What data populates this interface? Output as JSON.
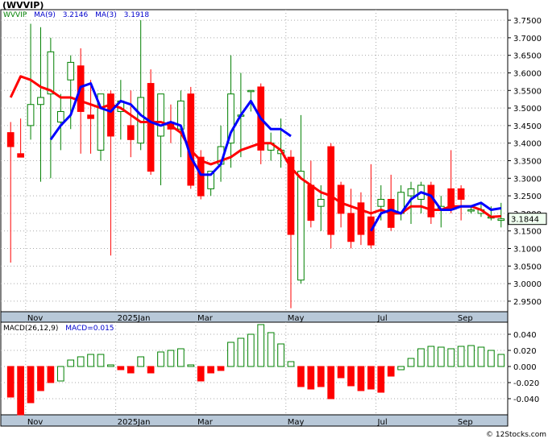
{
  "header": {
    "title": "(WVVIP)",
    "legend": [
      {
        "label": "WVVIP",
        "color": "#008000"
      },
      {
        "label": "MA(9)",
        "color": "#0000cc"
      },
      {
        "label": "3.2146",
        "color": "#0000cc"
      },
      {
        "label": "MA(3)",
        "color": "#0000cc"
      },
      {
        "label": "3.1918",
        "color": "#0000cc"
      }
    ],
    "macd_legend": [
      {
        "label": "MACD(26,12,9)",
        "color": "#000000"
      },
      {
        "label": "MACD=0.015",
        "color": "#0000cc"
      }
    ],
    "credit": "© 12Stocks.com"
  },
  "colors": {
    "up": "#008000",
    "down": "#ff0000",
    "ma9": "#0000ff",
    "ma3": "#ff0000",
    "grid": "#aaaaaa",
    "axis_bg": "#b8c8d8"
  },
  "chart_data": [
    {
      "type": "candlestick",
      "ylim": [
        2.92,
        3.78
      ],
      "yticks": [
        "3.7500",
        "3.7000",
        "3.6500",
        "3.6000",
        "3.5500",
        "3.5000",
        "3.4500",
        "3.4000",
        "3.3500",
        "3.3000",
        "3.2500",
        "3.2000",
        "3.1500",
        "3.1000",
        "3.0500",
        "3.0000",
        "2.9500"
      ],
      "ytick_values": [
        3.75,
        3.7,
        3.65,
        3.6,
        3.55,
        3.5,
        3.45,
        3.4,
        3.35,
        3.3,
        3.25,
        3.2,
        3.15,
        3.1,
        3.05,
        3.0,
        2.95
      ],
      "xticks": [
        {
          "label": "Nov",
          "i": 2
        },
        {
          "label": "2025Jan",
          "i": 11
        },
        {
          "label": "Mar",
          "i": 19
        },
        {
          "label": "May",
          "i": 28
        },
        {
          "label": "Jul",
          "i": 37
        },
        {
          "label": "Sep",
          "i": 45
        }
      ],
      "last_price_label": "3.1844",
      "last_price": 3.1844,
      "ohlc": [
        [
          3.43,
          3.46,
          3.06,
          3.39
        ],
        [
          3.37,
          3.47,
          3.36,
          3.36
        ],
        [
          3.45,
          3.74,
          3.41,
          3.51
        ],
        [
          3.51,
          3.73,
          3.29,
          3.53
        ],
        [
          3.54,
          3.7,
          3.3,
          3.66
        ],
        [
          3.46,
          3.54,
          3.38,
          3.49
        ],
        [
          3.58,
          3.65,
          3.44,
          3.63
        ],
        [
          3.62,
          3.67,
          3.37,
          3.49
        ],
        [
          3.48,
          3.58,
          3.37,
          3.47
        ],
        [
          3.38,
          3.53,
          3.35,
          3.54
        ],
        [
          3.54,
          3.55,
          3.08,
          3.42
        ],
        [
          3.49,
          3.58,
          3.41,
          3.52
        ],
        [
          3.45,
          3.55,
          3.36,
          3.41
        ],
        [
          3.4,
          3.75,
          3.38,
          3.53
        ],
        [
          3.57,
          3.61,
          3.31,
          3.32
        ],
        [
          3.42,
          3.52,
          3.28,
          3.54
        ],
        [
          3.46,
          3.51,
          3.4,
          3.44
        ],
        [
          3.44,
          3.55,
          3.36,
          3.52
        ],
        [
          3.54,
          3.56,
          3.27,
          3.28
        ],
        [
          3.36,
          3.38,
          3.24,
          3.25
        ],
        [
          3.27,
          3.31,
          3.25,
          3.32
        ],
        [
          3.34,
          3.45,
          3.29,
          3.39
        ],
        [
          3.4,
          3.65,
          3.33,
          3.54
        ],
        [
          3.48,
          3.6,
          3.36,
          3.48
        ],
        [
          3.55,
          3.55,
          3.49,
          3.55
        ],
        [
          3.56,
          3.57,
          3.34,
          3.38
        ],
        [
          3.38,
          3.43,
          3.35,
          3.4
        ],
        [
          3.37,
          3.47,
          3.33,
          3.38
        ],
        [
          3.36,
          3.38,
          2.93,
          3.14
        ],
        [
          3.01,
          3.48,
          3.0,
          3.32
        ],
        [
          3.28,
          3.35,
          3.16,
          3.18
        ],
        [
          3.22,
          3.28,
          3.15,
          3.24
        ],
        [
          3.39,
          3.4,
          3.1,
          3.14
        ],
        [
          3.28,
          3.29,
          3.16,
          3.2
        ],
        [
          3.2,
          3.27,
          3.1,
          3.12
        ],
        [
          3.23,
          3.26,
          3.11,
          3.14
        ],
        [
          3.19,
          3.34,
          3.1,
          3.11
        ],
        [
          3.22,
          3.28,
          3.18,
          3.24
        ],
        [
          3.24,
          3.31,
          3.15,
          3.16
        ],
        [
          3.2,
          3.28,
          3.18,
          3.26
        ],
        [
          3.25,
          3.29,
          3.17,
          3.27
        ],
        [
          3.24,
          3.29,
          3.2,
          3.28
        ],
        [
          3.28,
          3.29,
          3.17,
          3.19
        ],
        [
          3.21,
          3.25,
          3.16,
          3.22
        ],
        [
          3.27,
          3.38,
          3.2,
          3.21
        ],
        [
          3.27,
          3.28,
          3.18,
          3.24
        ],
        [
          3.21,
          3.22,
          3.2,
          3.21
        ],
        [
          3.2,
          3.23,
          3.19,
          3.21
        ],
        [
          3.19,
          3.22,
          3.18,
          3.19
        ],
        [
          3.18,
          3.23,
          3.16,
          3.1844
        ]
      ],
      "ma9": [
        null,
        null,
        null,
        null,
        3.41,
        3.45,
        3.48,
        3.56,
        3.57,
        3.5,
        3.49,
        3.52,
        3.51,
        3.48,
        3.46,
        3.45,
        3.46,
        3.45,
        3.36,
        3.31,
        3.31,
        3.34,
        3.43,
        3.48,
        3.52,
        3.47,
        3.44,
        3.44,
        3.42,
        null,
        null,
        null,
        null,
        null,
        null,
        null,
        3.15,
        3.2,
        3.21,
        3.2,
        3.24,
        3.26,
        3.25,
        3.21,
        3.21,
        3.22,
        3.22,
        3.23,
        3.21,
        3.2146
      ],
      "ma3": [
        3.53,
        3.59,
        3.58,
        3.56,
        3.55,
        3.53,
        3.53,
        3.52,
        3.51,
        3.5,
        3.51,
        3.5,
        3.48,
        3.46,
        3.46,
        3.46,
        3.45,
        3.43,
        3.38,
        3.35,
        3.34,
        3.35,
        3.36,
        3.38,
        3.39,
        3.4,
        3.4,
        3.38,
        3.33,
        3.3,
        3.28,
        3.26,
        3.25,
        3.23,
        3.22,
        3.21,
        3.2,
        3.21,
        3.2,
        3.2,
        3.22,
        3.22,
        3.21,
        3.21,
        3.22,
        3.22,
        3.22,
        3.21,
        3.19,
        3.1918
      ]
    },
    {
      "type": "bar",
      "title": "MACD(26,12,9)",
      "ylim": [
        -0.06,
        0.055
      ],
      "yticks": [
        "0.040",
        "0.020",
        "0.000",
        "-0.020",
        "-0.040"
      ],
      "ytick_values": [
        0.04,
        0.02,
        0.0,
        -0.02,
        -0.04
      ],
      "values": [
        -0.038,
        -0.06,
        -0.045,
        -0.03,
        -0.02,
        -0.018,
        0.008,
        0.012,
        0.015,
        0.015,
        0.002,
        -0.004,
        -0.008,
        0.012,
        -0.008,
        0.018,
        0.02,
        0.022,
        0.002,
        -0.018,
        -0.008,
        -0.005,
        0.03,
        0.035,
        0.04,
        0.052,
        0.042,
        0.028,
        0.006,
        -0.025,
        -0.028,
        -0.025,
        -0.04,
        -0.014,
        -0.024,
        -0.03,
        -0.028,
        -0.032,
        -0.012,
        -0.004,
        0.01,
        0.022,
        0.025,
        0.024,
        0.022,
        0.025,
        0.026,
        0.024,
        0.02,
        0.015
      ],
      "values_color": [
        0,
        0,
        0,
        0,
        0,
        1,
        1,
        1,
        1,
        1,
        1,
        0,
        0,
        1,
        0,
        1,
        1,
        1,
        1,
        0,
        0,
        0,
        1,
        1,
        1,
        1,
        1,
        1,
        1,
        0,
        0,
        0,
        0,
        0,
        0,
        0,
        0,
        0,
        0,
        1,
        1,
        1,
        1,
        1,
        1,
        1,
        1,
        1,
        1,
        1
      ]
    }
  ]
}
